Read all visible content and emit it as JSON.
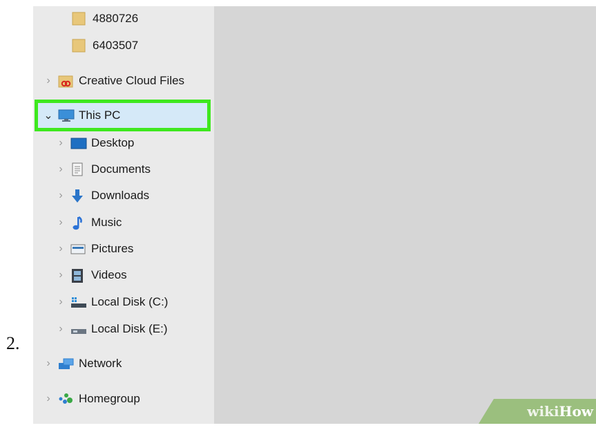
{
  "step_number": "2.",
  "nav": {
    "items": [
      {
        "label": "4880726",
        "icon": "folder-icon"
      },
      {
        "label": "6403507",
        "icon": "folder-icon"
      },
      {
        "label": "Creative Cloud Files",
        "icon": "creative-cloud-folder-icon"
      },
      {
        "label": "This PC",
        "icon": "monitor-icon",
        "expanded": true,
        "selected": true
      },
      {
        "label": "Desktop",
        "icon": "desktop-icon"
      },
      {
        "label": "Documents",
        "icon": "documents-icon"
      },
      {
        "label": "Downloads",
        "icon": "download-arrow-icon"
      },
      {
        "label": "Music",
        "icon": "music-note-icon"
      },
      {
        "label": "Pictures",
        "icon": "pictures-icon"
      },
      {
        "label": "Videos",
        "icon": "videos-icon"
      },
      {
        "label": "Local Disk (C:)",
        "icon": "local-disk-c-icon"
      },
      {
        "label": "Local Disk (E:)",
        "icon": "local-disk-e-icon"
      },
      {
        "label": "Network",
        "icon": "network-icon"
      },
      {
        "label": "Homegroup",
        "icon": "homegroup-icon"
      }
    ]
  },
  "colors": {
    "highlight_border": "#3ee81f",
    "selected_background": "#d5e9f8",
    "nav_background": "#eaeaea",
    "content_background": "#d6d6d6",
    "watermark_background": "#9bbf7e"
  },
  "watermark": {
    "part1": "wiki",
    "part2": "How"
  }
}
